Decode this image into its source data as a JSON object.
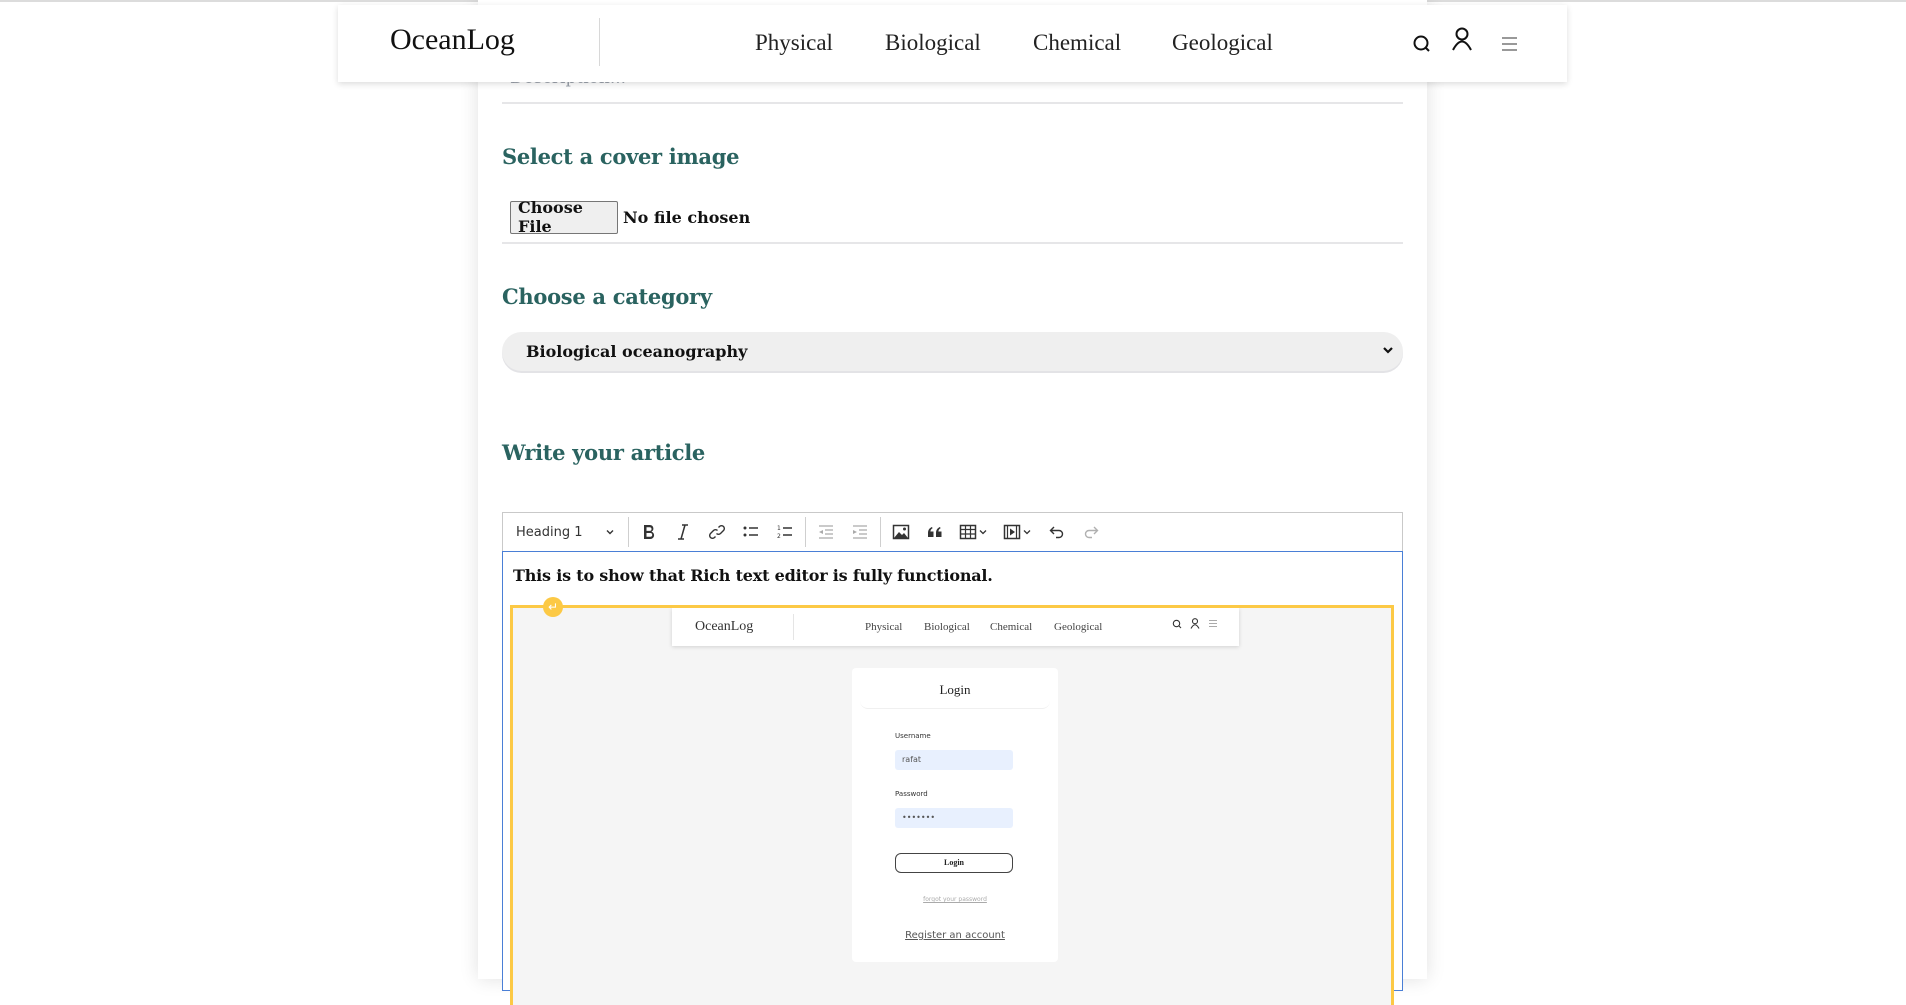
{
  "header": {
    "logo": "OceanLog",
    "nav": [
      "Physical",
      "Biological",
      "Chemical",
      "Geological"
    ],
    "icons": [
      "search-icon",
      "user-icon",
      "menu-icon"
    ]
  },
  "form": {
    "description_placeholder": "Description...",
    "cover_heading": "Select a cover image",
    "file_button": "Choose File",
    "file_status": "No file chosen",
    "category_heading": "Choose a category",
    "category_selected": "Biological oceanography",
    "article_heading": "Write your article"
  },
  "editor": {
    "toolbar": {
      "heading_select": "Heading 1",
      "buttons": [
        "bold",
        "italic",
        "link",
        "bulleted-list",
        "numbered-list",
        "outdent",
        "indent",
        "insert-image",
        "block-quote",
        "insert-table",
        "insert-media",
        "undo",
        "redo"
      ]
    },
    "content_text": "This is to show that Rich text editor is fully functional.",
    "embedded_image": {
      "logo": "OceanLog",
      "nav": [
        "Physical",
        "Biological",
        "Chemical",
        "Geological"
      ],
      "login_title": "Login",
      "username_label": "Username",
      "username_value": "rafat",
      "password_label": "Password",
      "password_value": "•••••••",
      "login_button": "Login",
      "forgot_link": "forgot your password",
      "register_link": "Register an account"
    }
  },
  "colors": {
    "heading": "#2a6360",
    "image_selection": "#fcc945",
    "editor_focus": "#4a7fd6"
  }
}
